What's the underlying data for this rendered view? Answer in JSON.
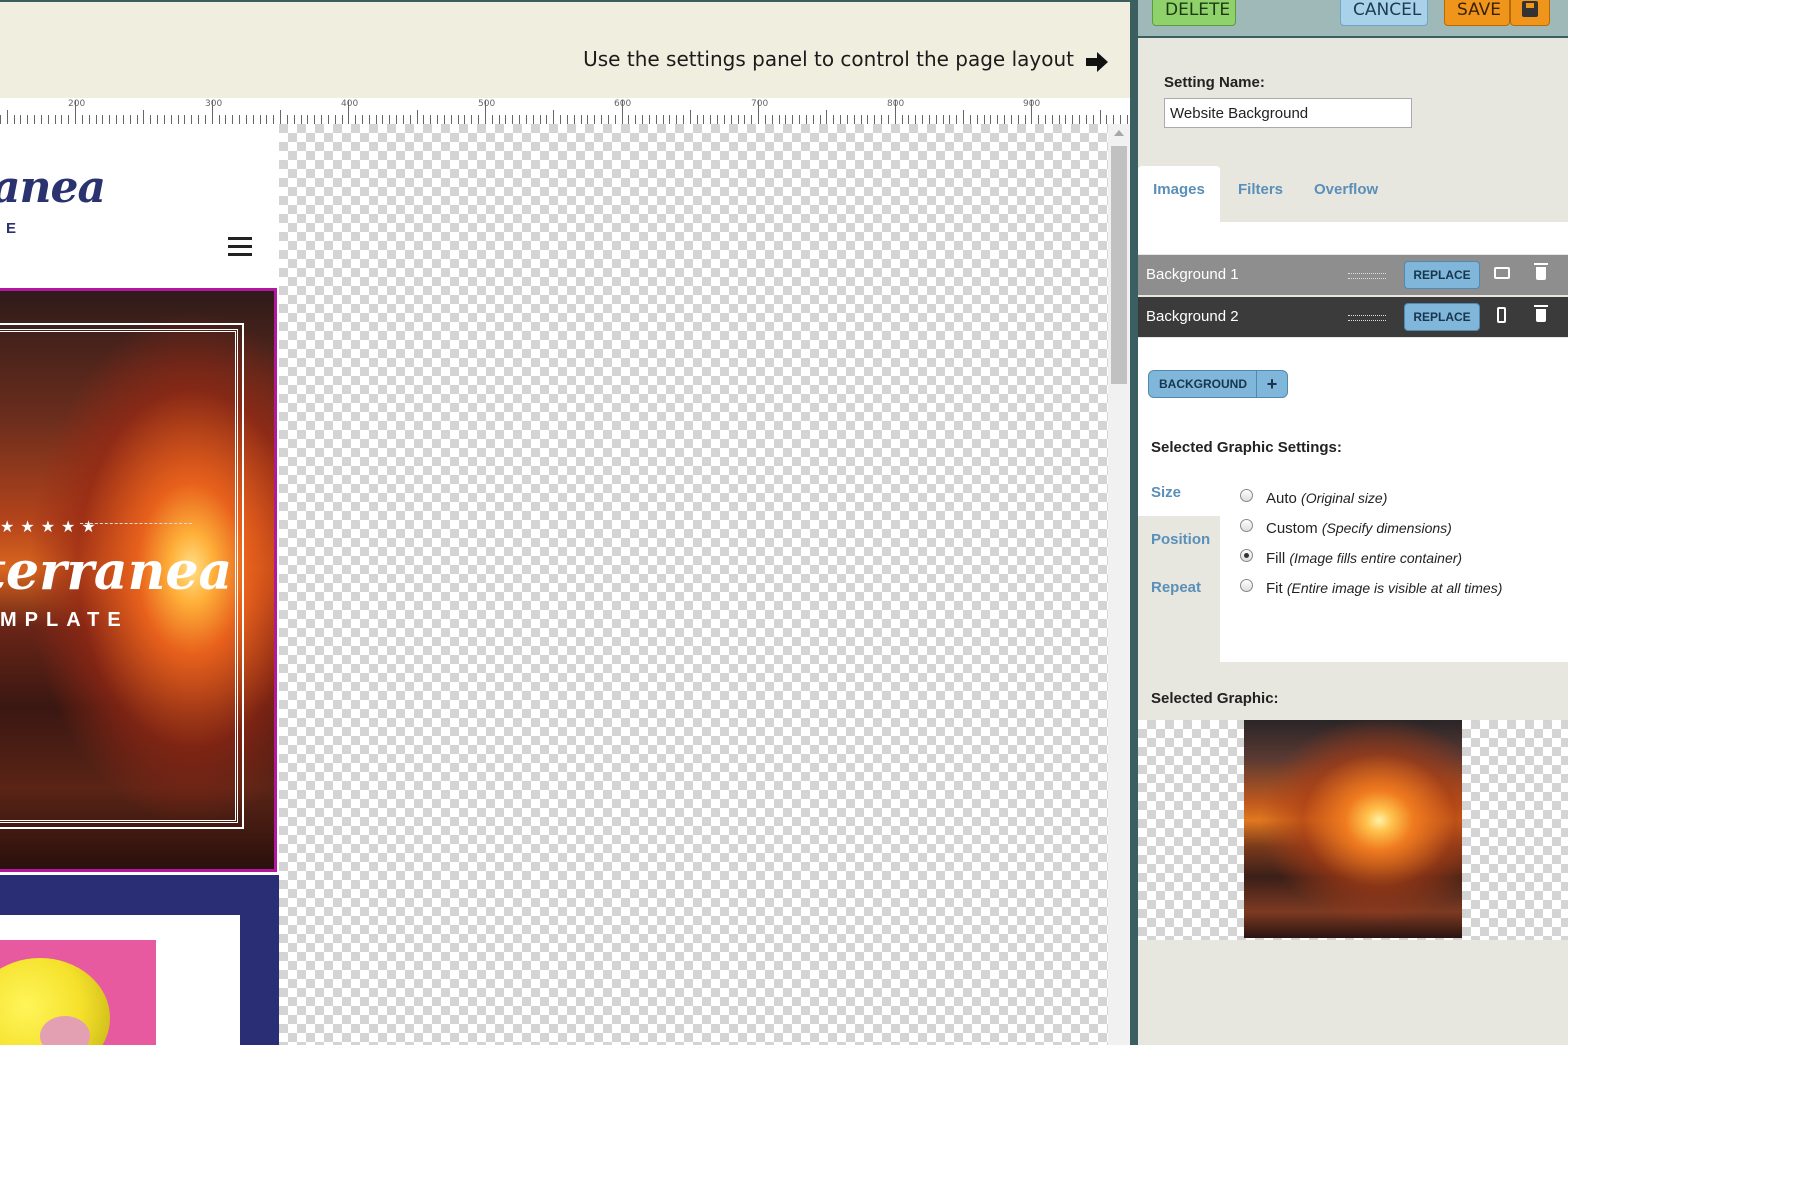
{
  "canvas": {
    "hint_text": "Use the settings panel to control the page layout",
    "ruler_labels": [
      "200",
      "300",
      "400",
      "500",
      "600",
      "700",
      "800",
      "900"
    ]
  },
  "site_preview": {
    "logo_text": "anea",
    "logo_sub": "E",
    "hero_stars": "★★★★★",
    "hero_title": "terranea",
    "hero_subtitle": "MPLATE",
    "colors": {
      "brand": "#2b3270",
      "hero_border": "#b3169f",
      "band": "#2a2f75"
    }
  },
  "toolbar": {
    "delete_label": "DELETE",
    "cancel_label": "CANCEL",
    "save_label": "SAVE"
  },
  "settings": {
    "setting_name_label": "Setting Name:",
    "setting_name_value": "Website Background",
    "tabs": [
      {
        "label": "Images",
        "active": true
      },
      {
        "label": "Filters",
        "active": false
      },
      {
        "label": "Overflow",
        "active": false
      }
    ],
    "backgrounds": [
      {
        "name": "Background 1",
        "replace_label": "REPLACE",
        "device_icon": "desktop-icon"
      },
      {
        "name": "Background 2",
        "replace_label": "REPLACE",
        "device_icon": "mobile-icon"
      }
    ],
    "add_background_label": "BACKGROUND",
    "add_background_plus": "+",
    "selected_graphic_settings_label": "Selected Graphic Settings:",
    "side_tabs": [
      "Size",
      "Position",
      "Repeat"
    ],
    "size_options": [
      {
        "label": "Auto",
        "hint": "(Original size)",
        "selected": false
      },
      {
        "label": "Custom",
        "hint": "(Specify dimensions)",
        "selected": false
      },
      {
        "label": "Fill",
        "hint": "(Image fills entire container)",
        "selected": true
      },
      {
        "label": "Fit",
        "hint": "(Entire image is visible at all times)",
        "selected": false
      }
    ],
    "selected_graphic_label": "Selected Graphic:"
  },
  "colors": {
    "panel_bg": "#e7e7e0",
    "accent_blue": "#7fb6d9",
    "delete_green": "#8fd26b",
    "save_orange": "#f0951c",
    "divider": "#3b5f60"
  }
}
